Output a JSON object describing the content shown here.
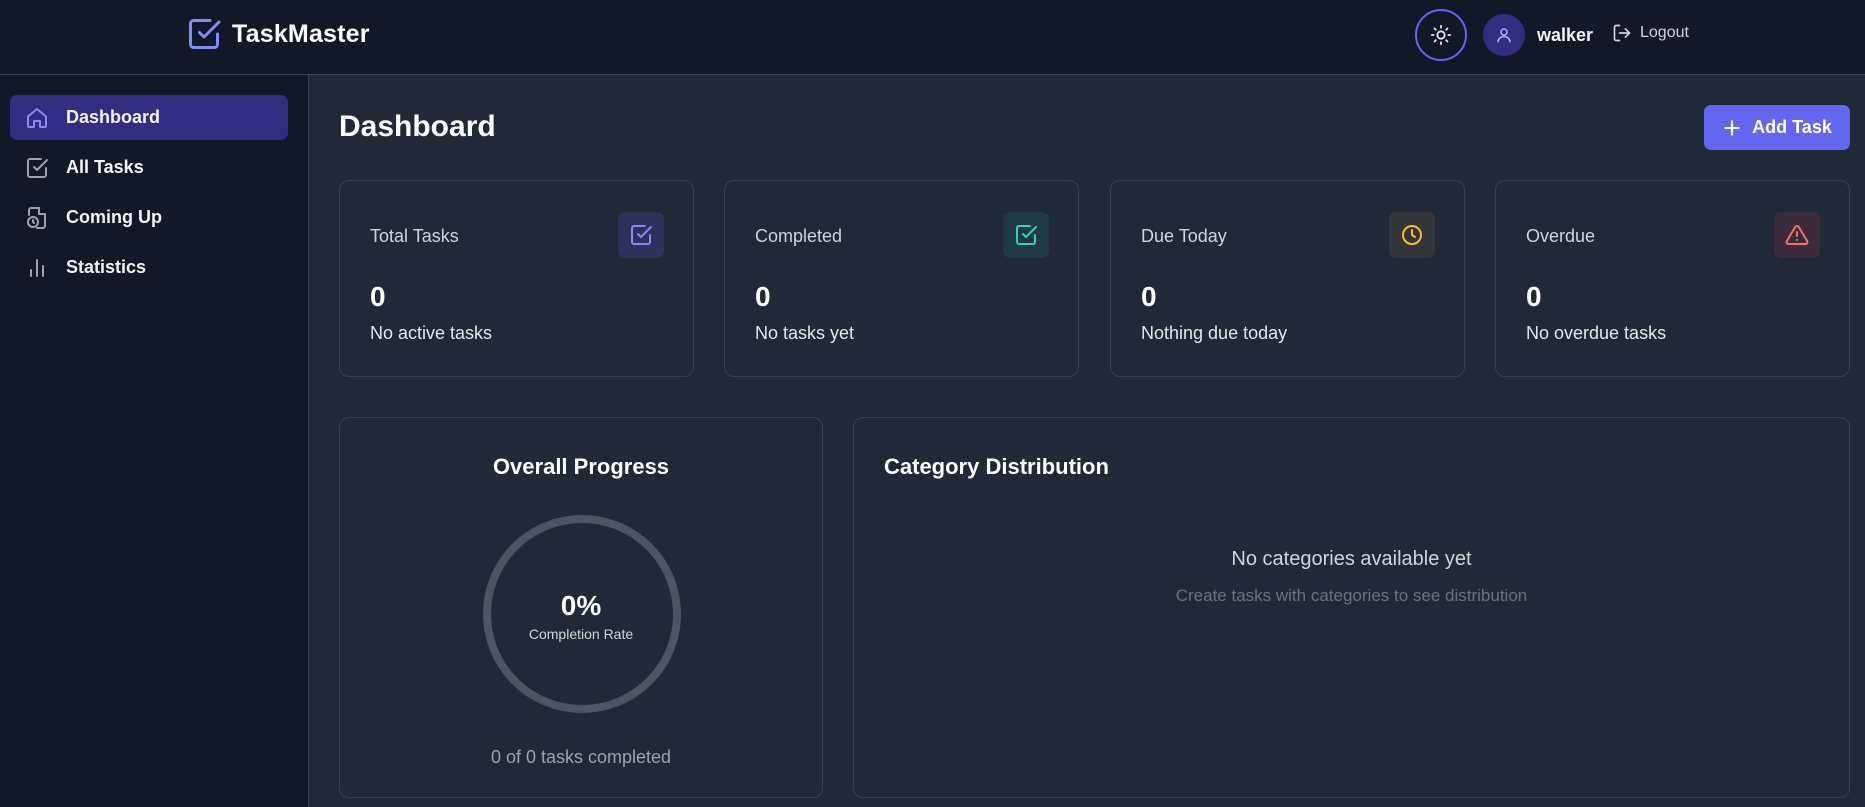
{
  "app": {
    "title": "TaskMaster"
  },
  "header": {
    "username": "walker",
    "logout_label": "Logout"
  },
  "sidebar": {
    "items": [
      {
        "label": "Dashboard",
        "icon": "home-icon",
        "active": true
      },
      {
        "label": "All Tasks",
        "icon": "check-square-icon",
        "active": false
      },
      {
        "label": "Coming Up",
        "icon": "file-clock-icon",
        "active": false
      },
      {
        "label": "Statistics",
        "icon": "bar-chart-icon",
        "active": false
      }
    ]
  },
  "page": {
    "title": "Dashboard",
    "add_button_label": "Add Task"
  },
  "stats": [
    {
      "label": "Total Tasks",
      "value": "0",
      "sub": "No active tasks",
      "icon": "check-square-icon",
      "color": "#818cf8"
    },
    {
      "label": "Completed",
      "value": "0",
      "sub": "No tasks yet",
      "icon": "check-square-icon",
      "color": "#2dd4bf"
    },
    {
      "label": "Due Today",
      "value": "0",
      "sub": "Nothing due today",
      "icon": "clock-icon",
      "color": "#fbbf24"
    },
    {
      "label": "Overdue",
      "value": "0",
      "sub": "No overdue tasks",
      "icon": "alert-triangle-icon",
      "color": "#f87171"
    }
  ],
  "progress": {
    "title": "Overall Progress",
    "percent": "0%",
    "percent_value": 0,
    "label": "Completion Rate",
    "footer": "0 of 0 tasks completed"
  },
  "category": {
    "title": "Category Distribution",
    "empty": "No categories available yet",
    "hint": "Create tasks with categories to see distribution"
  },
  "colors": {
    "accent": "#6366f1",
    "sidebar_bg": "#111827",
    "content_bg": "#1f2937",
    "active_nav": "#312e81"
  }
}
